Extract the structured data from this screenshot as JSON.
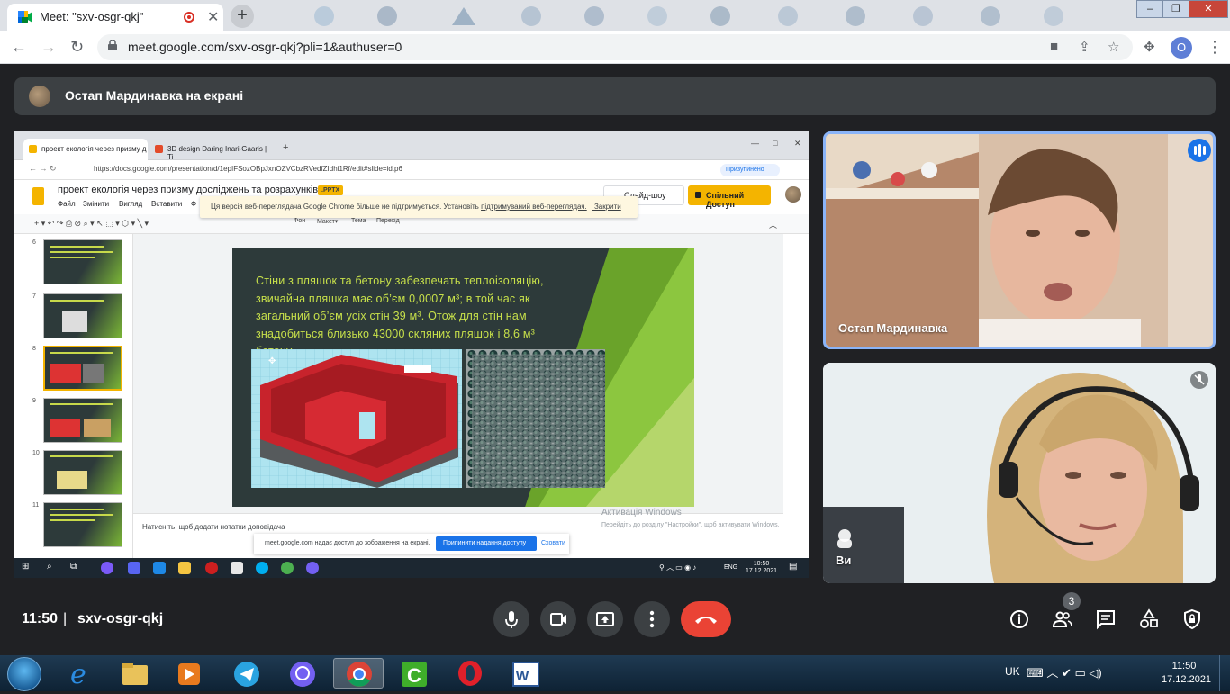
{
  "browser": {
    "tab_title": "Meet: \"sxv-osgr-qkj\"",
    "url": "meet.google.com/sxv-osgr-qkj?pli=1&authuser=0",
    "profile_initial": "O"
  },
  "presenting": {
    "text": "Остап Мардинавка на екрані"
  },
  "shared_screen": {
    "tabs": [
      {
        "label": "проект екологія через призму д",
        "color": "#f4b400"
      },
      {
        "label": "3D design Daring Inari-Gaaris | Ti",
        "color": "#e34b2a"
      }
    ],
    "url": "https://docs.google.com/presentation/d/1epIFSozOBpJxnOZVCbzRVedfZIdhi1Rf/edit#slide=id.p6",
    "badge": "Призупинено",
    "doc_title": "проект екологія через призму досліджень та розрахунків",
    "pptx": ".PPTX",
    "menu": [
      "Файл",
      "Змінити",
      "Вигляд",
      "Вставити",
      "Ф"
    ],
    "slideshow_label": "Слайд-шоу",
    "share_label": "Спільний Доступ",
    "warning_text": "Ця версія веб-переглядача Google Chrome більше не підтримується. Установіть",
    "warning_link": "підтримуваний веб-переглядач.",
    "warning_close": "Закрити",
    "toolbar_items": [
      "Фон",
      "Макет▾",
      "Тема",
      "Перехід"
    ],
    "thumb_numbers": [
      "6",
      "7",
      "8",
      "9",
      "10",
      "11"
    ],
    "slide_text": "Стіни з пляшок та бетону забезпечать теплоізоляцію, звичайна пляшка має об’єм 0,0007 м³; в той час як загальний об’єм усіх стін 39 м³. Отож для стін нам знадобиться близько 43000 скляних пляшок і 8,6 м³ бетону.",
    "notes_placeholder": "Натисніть, щоб додати нотатки доповідача",
    "activation_title": "Активація Windows",
    "activation_sub": "Перейдіть до розділу \"Настройки\", щоб активувати Windows.",
    "sharebar_text": "meet.google.com надає доступ до зображення на екрані.",
    "sharebar_stop": "Припинити надання доступу",
    "sharebar_hide": "Сховати",
    "tray_lang": "ENG",
    "tray_time": "10:50",
    "tray_date": "17.12.2021"
  },
  "participants": [
    {
      "name": "Остап Мардинавка",
      "speaking": true
    },
    {
      "name": "Ви",
      "muted": true
    }
  ],
  "meeting": {
    "time": "11:50",
    "separator": "|",
    "code": "sxv-osgr-qkj",
    "people_count": "3"
  },
  "windows": {
    "lang": "UK",
    "time": "11:50",
    "date": "17.12.2021"
  },
  "colors": {
    "meet_bg": "#202124",
    "end_call": "#ea4335",
    "accent_blue": "#1a73e8",
    "slide_text": "#c7e04a"
  }
}
